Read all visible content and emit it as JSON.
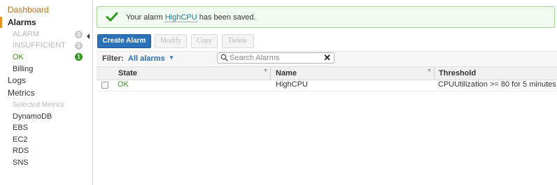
{
  "sidebar": {
    "dashboard": "Dashboard",
    "alarms": "Alarms",
    "alarm_states": [
      {
        "label": "ALARM",
        "count": "0"
      },
      {
        "label": "INSUFFICIENT",
        "count": "0"
      },
      {
        "label": "OK",
        "count": "1"
      }
    ],
    "billing": "Billing",
    "logs": "Logs",
    "metrics": "Metrics",
    "selected_metrics": "Selected Metrics",
    "metric_items": [
      "DynamoDB",
      "EBS",
      "EC2",
      "RDS",
      "SNS"
    ]
  },
  "notice": {
    "prefix": "Your alarm ",
    "alarm_name": "HighCPU",
    "suffix": " has been saved."
  },
  "toolbar": {
    "create": "Create Alarm",
    "modify": "Modify",
    "copy": "Copy",
    "delete": "Delete"
  },
  "filter": {
    "label": "Filter:",
    "value": "All alarms"
  },
  "search": {
    "placeholder": "Search Alarms",
    "value": ""
  },
  "table": {
    "headers": {
      "state": "State",
      "name": "Name",
      "threshold": "Threshold"
    },
    "rows": [
      {
        "state": "OK",
        "name": "HighCPU",
        "threshold": "CPUUtilization >= 80 for 5 minutes"
      }
    ]
  },
  "colors": {
    "primary": "#2c72b9",
    "ok_green": "#3a9a1c",
    "link_orange": "#b8701f",
    "success_border": "#a4d69a"
  }
}
